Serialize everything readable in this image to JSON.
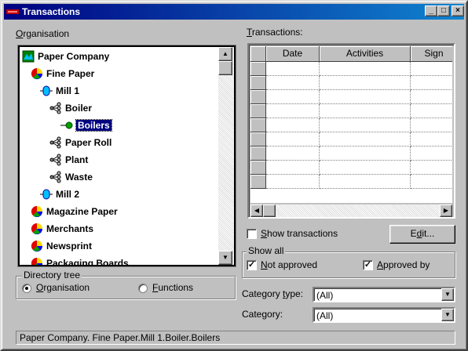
{
  "window": {
    "title": "Transactions",
    "controls": {
      "minimize": "_",
      "maximize": "□",
      "close": "×"
    }
  },
  "organisation": {
    "label_prefix": "",
    "label_accel": "O",
    "label_rest": "rganisation",
    "tree": [
      {
        "label": "Paper Company",
        "icon": "company-icon",
        "indent": 0
      },
      {
        "label": "Fine Paper",
        "icon": "division-pie-icon",
        "indent": 1
      },
      {
        "label": "Mill 1",
        "icon": "mill-icon",
        "indent": 2
      },
      {
        "label": "Boiler",
        "icon": "hierarchy-icon",
        "indent": 3
      },
      {
        "label": "Boilers",
        "icon": "leaf-node-icon",
        "indent": 4,
        "selected": true
      },
      {
        "label": "Paper Roll",
        "icon": "hierarchy-icon",
        "indent": 3
      },
      {
        "label": "Plant",
        "icon": "hierarchy-icon",
        "indent": 3
      },
      {
        "label": "Waste",
        "icon": "hierarchy-icon",
        "indent": 3
      },
      {
        "label": "Mill 2",
        "icon": "mill-icon",
        "indent": 2
      },
      {
        "label": "Magazine Paper",
        "icon": "division-pie-icon",
        "indent": 1
      },
      {
        "label": "Merchants",
        "icon": "division-pie-icon",
        "indent": 1
      },
      {
        "label": "Newsprint",
        "icon": "division-pie-icon",
        "indent": 1
      },
      {
        "label": "Packaging Boards",
        "icon": "division-pie-icon",
        "indent": 1
      }
    ]
  },
  "directory_tree": {
    "title": "Directory tree",
    "options": [
      {
        "accel": "O",
        "rest": "rganisation",
        "selected": true
      },
      {
        "accel": "F",
        "rest": "unctions",
        "selected": false
      }
    ]
  },
  "transactions": {
    "label_accel": "T",
    "label_rest": "ransactions:",
    "columns": [
      "Date",
      "Activities",
      "Sign"
    ],
    "row_count": 9
  },
  "show_transactions": {
    "accel": "S",
    "rest": "how transactions",
    "checked": false
  },
  "edit_button": {
    "prefix": "E",
    "accel": "d",
    "rest": "it..."
  },
  "show_all": {
    "title": "Show all",
    "not_approved": {
      "accel": "N",
      "rest": "ot approved",
      "checked": true
    },
    "approved_by": {
      "accel": "A",
      "rest": "pproved by",
      "checked": true
    }
  },
  "category_type": {
    "prefix": "Category ",
    "accel": "t",
    "rest": "ype:",
    "value": "(All)"
  },
  "category": {
    "label": "Category:",
    "value": "(All)"
  },
  "status": {
    "path": "Paper Company. Fine Paper.Mill 1.Boiler.Boilers"
  },
  "colors": {
    "title_start": "#000080",
    "title_end": "#1084d0",
    "selection": "#000080"
  }
}
